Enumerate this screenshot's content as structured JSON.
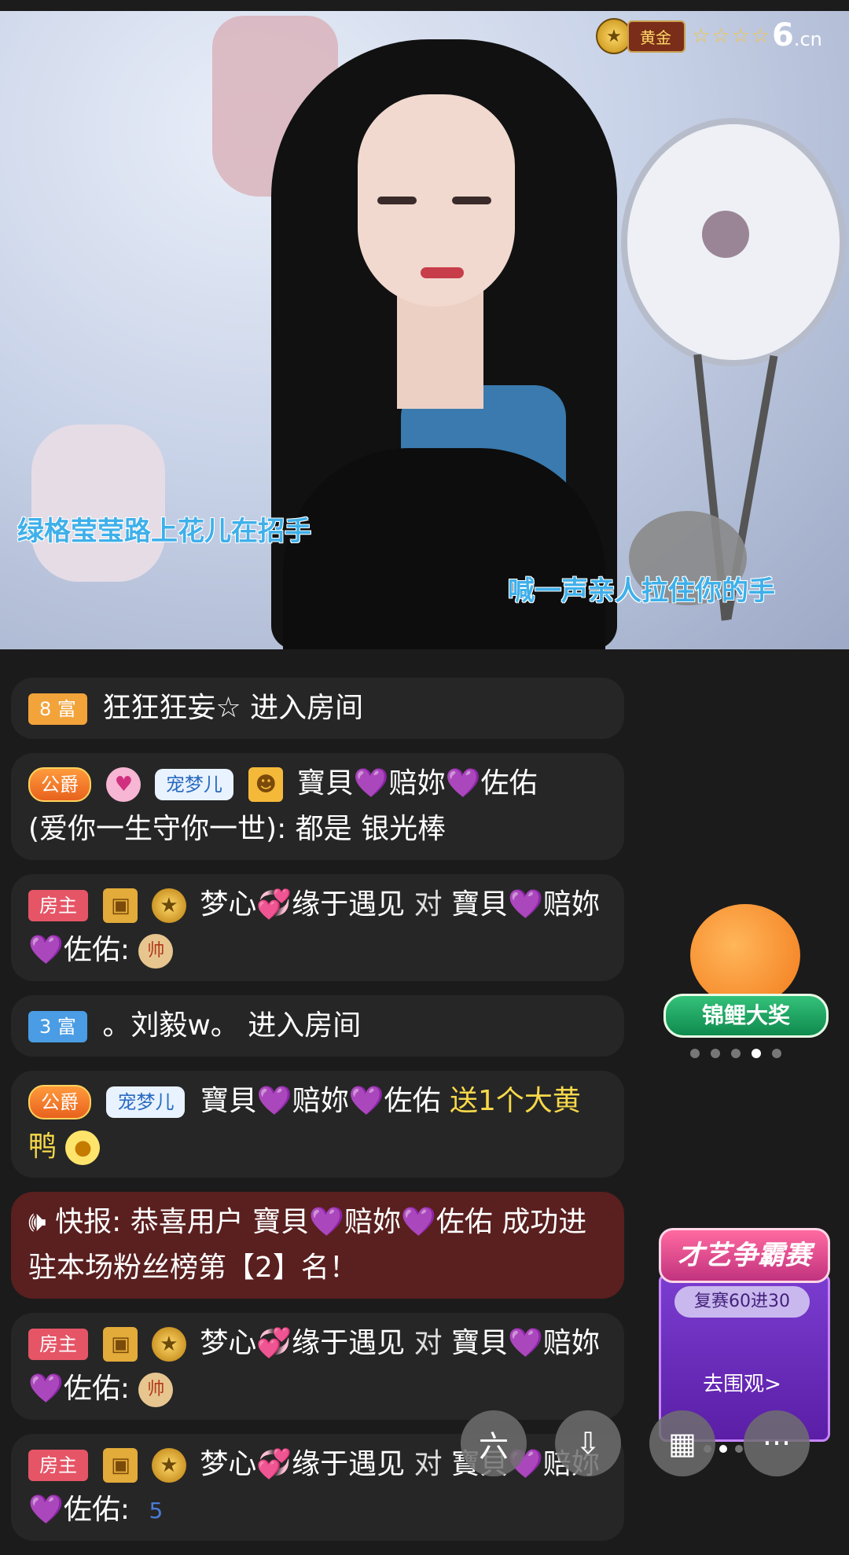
{
  "overlay": {
    "level_badge": "黄金",
    "stars": "☆☆☆☆",
    "site_logo_main": "6",
    "site_logo_suffix": ".cn"
  },
  "lyrics": {
    "line1": "绿格莹莹路上花儿在招手",
    "line2": "喊一声亲人拉住你的手"
  },
  "chat": [
    {
      "tag": "8 富",
      "text": "狂狂狂妄☆ 进入房间"
    },
    {
      "tag": "公爵",
      "pet": "宠梦儿",
      "name": "寶貝💜赔妳💜佐佑",
      "body": "(爱你一生守你一世): 都是  银光棒"
    },
    {
      "tag": "房主",
      "name": "梦心💞缘于遇见",
      "mid": "对",
      "target": "寶貝💜赔妳💜佐佑:",
      "chess": "帅"
    },
    {
      "tag": "3 富",
      "text": "。刘毅w。 进入房间"
    },
    {
      "tag": "公爵",
      "pet": "宠梦儿",
      "name": "寶貝💜赔妳💜佐佑",
      "gift": "送1个大黄鸭"
    },
    {
      "alert": "快报: 恭喜用户 寶貝💜赔妳💜佐佑 成功进驻本场粉丝榜第【2】名！"
    },
    {
      "tag": "房主",
      "name": "梦心💞缘于遇见",
      "mid": "对",
      "target": "寶貝💜赔妳💜佐佑:",
      "chess": "帅"
    },
    {
      "tag": "房主",
      "name": "梦心💞缘于遇见",
      "mid": "对",
      "target": "寶貝💜赔妳💜佐佑:",
      "badge": "5"
    }
  ],
  "koi": {
    "label": "锦鲤大奖"
  },
  "contest": {
    "title": "才艺争霸赛",
    "subtitle": "复赛60进30",
    "action": "去围观>"
  },
  "buttons": {
    "six": "六",
    "download": "⇩",
    "grid": "▦",
    "more": "···"
  },
  "colors": {
    "lyric": "#3eb0ea",
    "gift": "#f7d84a",
    "alert_bg": "#5a1f1f"
  }
}
